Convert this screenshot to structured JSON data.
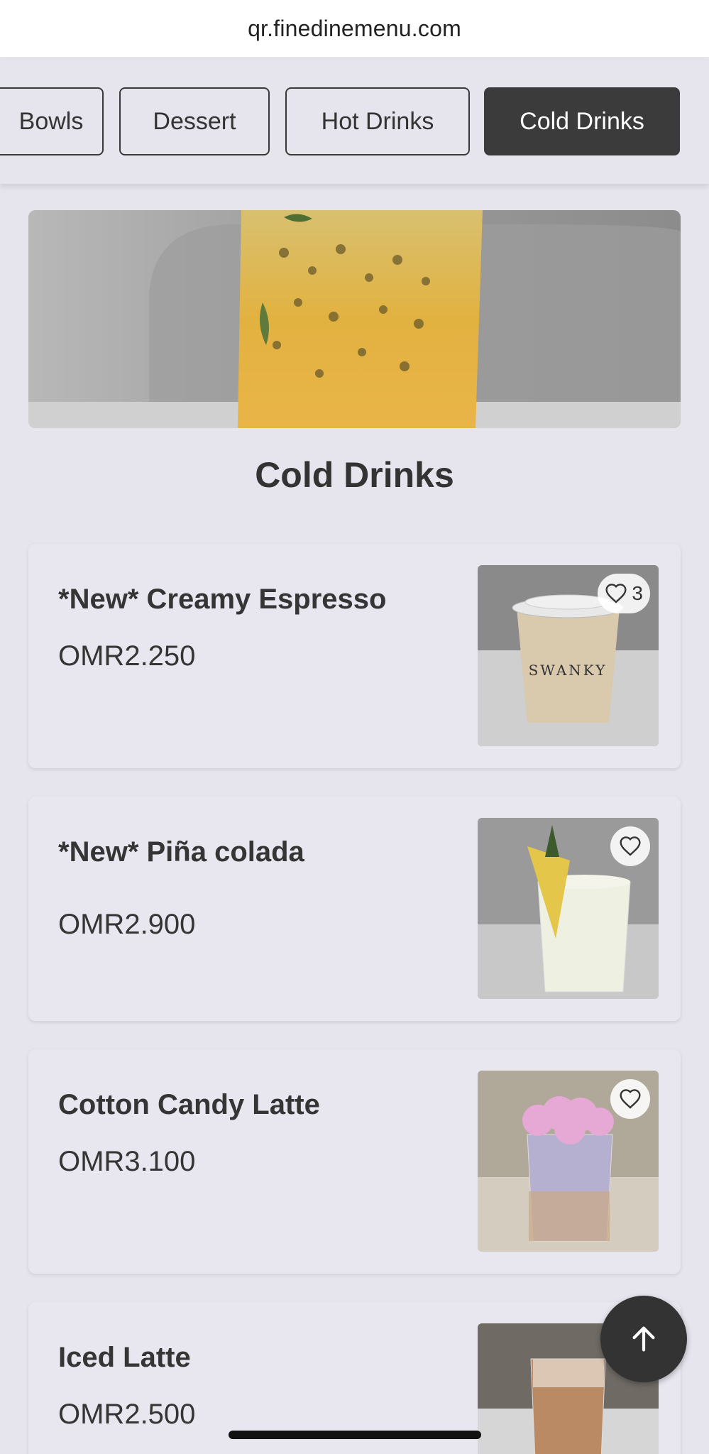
{
  "browser": {
    "url": "qr.finedinemenu.com"
  },
  "categories": [
    {
      "label": "Bowls",
      "active": false
    },
    {
      "label": "Dessert",
      "active": false
    },
    {
      "label": "Hot Drinks",
      "active": false
    },
    {
      "label": "Cold Drinks",
      "active": true
    }
  ],
  "section": {
    "title": "Cold Drinks"
  },
  "items": [
    {
      "name": "*New* Creamy Espresso",
      "price": "OMR2.250",
      "likes": "3",
      "image": "swanky-cup-photo"
    },
    {
      "name": "*New* Piña colada",
      "price": "OMR2.900",
      "likes": "",
      "image": "pina-colada-photo"
    },
    {
      "name": "Cotton Candy Latte",
      "price": "OMR3.100",
      "likes": "",
      "image": "cotton-candy-latte-photo"
    },
    {
      "name": "Iced Latte",
      "price": "OMR2.500",
      "likes": "",
      "image": "iced-latte-photo"
    }
  ],
  "icons": {
    "favorite": "heart-outline-icon",
    "scroll_top": "arrow-up-icon"
  },
  "colors": {
    "background": "#e6e4ec",
    "active_tab": "#3b3b3b",
    "text": "#333333"
  }
}
